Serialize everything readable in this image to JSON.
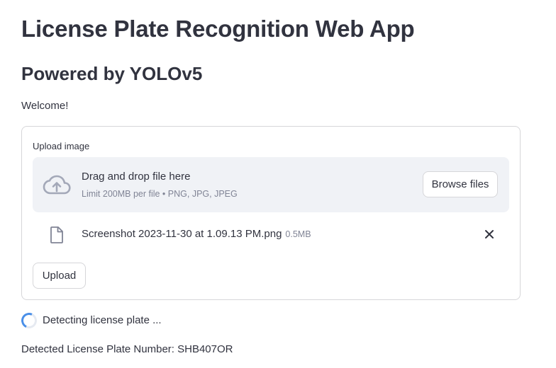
{
  "header": {
    "title": "License Plate Recognition Web App",
    "subtitle": "Powered by YOLOv5"
  },
  "welcome_text": "Welcome!",
  "form": {
    "upload_label": "Upload image",
    "dropzone": {
      "icon": "cloud-upload-icon",
      "title": "Drag and drop file here",
      "limit": "Limit 200MB per file • PNG, JPG, JPEG",
      "browse_label": "Browse files"
    },
    "file": {
      "icon": "file-icon",
      "name": "Screenshot 2023-11-30 at 1.09.13 PM.png",
      "size": "0.5MB",
      "remove_icon": "close-icon"
    },
    "submit_label": "Upload"
  },
  "status": {
    "icon": "spinner-icon",
    "text": "Detecting license plate ..."
  },
  "result_text": "Detected License Plate Number: SHB407OR",
  "colors": {
    "text": "#31333f",
    "muted": "#808495",
    "dropzone_bg": "#f0f2f6",
    "border": "#d6d6d9",
    "spinner_accent": "#4a8fe8"
  }
}
